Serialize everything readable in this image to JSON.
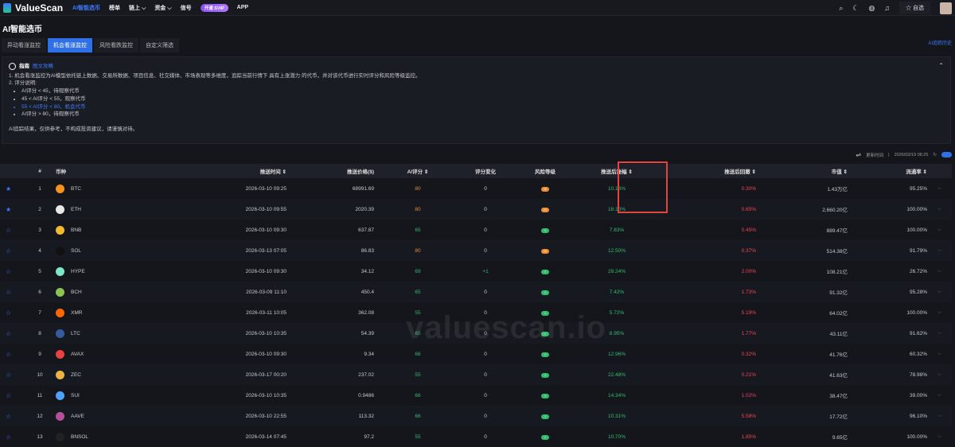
{
  "brand": "ValueScan",
  "nav": [
    "AI智能选币",
    "榜单",
    "链上 ⌵",
    "资金 ⌵",
    "信号"
  ],
  "svip": "开通 SVIP",
  "app": "APP",
  "fav": "☆ 自选",
  "title": "AI智能选币",
  "tabs": [
    "异动看涨监控",
    "机会看涨监控",
    "风险看跌监控",
    "自定义筛选"
  ],
  "history": "AI追踪历史",
  "guide": {
    "title": "指南",
    "link": "图文攻略",
    "line1": "1. 机会看涨监控为AI模型依托链上数据、交易所数据、项目信息、社交媒体、市场表现等多维度，追踪当前行情下 具有上涨潜力 的代币，并对该代币进行实时评分和风险等级监控。",
    "line2": "2. 评分说明:",
    "items": [
      "AI评分 < 45，待观察代币",
      "45 < AI评分 < 55，观察代币",
      "55 < AI评分 < 80，机会代币",
      "AI评分 > 80，待观察代币"
    ],
    "disclaimer": "AI追踪结果，仅供参考，不构成投资建议，请谨慎对待。"
  },
  "update": {
    "label": "更新时间",
    "time": "2026/03/19 08:25"
  },
  "headers": [
    "#",
    "币种",
    "推送时间 ⇕",
    "推送价格($)",
    "AI评分 ⇕",
    "评分变化",
    "风险等级",
    "推送后涨幅 ⇕",
    "推送后回撤 ⇕",
    "市值 ⇕",
    "流通率 ⇕"
  ],
  "rows": [
    {
      "n": "1",
      "sym": "BTC",
      "time": "2026-03-10 09:25",
      "price": "68991.69",
      "score": "80",
      "chg": "0",
      "risk": "high",
      "rise": "10.16%",
      "dd": "0.30%",
      "mcap": "1.43万亿",
      "circ": "95.25%",
      "fav": true,
      "color": "#f7931a"
    },
    {
      "n": "2",
      "sym": "ETH",
      "time": "2026-03-10 09:55",
      "price": "2020.39",
      "score": "80",
      "chg": "0",
      "risk": "high",
      "rise": "18.10%",
      "dd": "0.65%",
      "mcap": "2,660.20亿",
      "circ": "100.00%",
      "fav": true,
      "color": "#e8e8e8"
    },
    {
      "n": "3",
      "sym": "BNB",
      "time": "2026-03-10 09:30",
      "price": "637.87",
      "score": "65",
      "chg": "0",
      "risk": "low",
      "rise": "7.83%",
      "dd": "0.45%",
      "mcap": "889.47亿",
      "circ": "100.00%",
      "fav": false,
      "color": "#f3ba2f"
    },
    {
      "n": "4",
      "sym": "SOL",
      "time": "2026-03-13 07:05",
      "price": "86.83",
      "score": "80",
      "chg": "0",
      "risk": "high",
      "rise": "12.50%",
      "dd": "0.37%",
      "mcap": "514.38亿",
      "circ": "91.79%",
      "fav": false,
      "color": "#111111"
    },
    {
      "n": "5",
      "sym": "HYPE",
      "time": "2026-03-10 09:30",
      "price": "34.12",
      "score": "69",
      "chg": "+1",
      "risk": "low",
      "rise": "28.24%",
      "dd": "2.00%",
      "mcap": "108.21亿",
      "circ": "26.72%",
      "fav": false,
      "color": "#7de8c9"
    },
    {
      "n": "6",
      "sym": "BCH",
      "time": "2026-03-09 11:10",
      "price": "450.4",
      "score": "65",
      "chg": "0",
      "risk": "low",
      "rise": "7.42%",
      "dd": "1.73%",
      "mcap": "91.32亿",
      "circ": "95.28%",
      "fav": false,
      "color": "#8dc351"
    },
    {
      "n": "7",
      "sym": "XMR",
      "time": "2026-03-11 10:05",
      "price": "362.08",
      "score": "55",
      "chg": "0",
      "risk": "low",
      "rise": "5.72%",
      "dd": "5.19%",
      "mcap": "64.02亿",
      "circ": "100.00%",
      "fav": false,
      "color": "#ff6600"
    },
    {
      "n": "8",
      "sym": "LTC",
      "time": "2026-03-10 10:35",
      "price": "54.39",
      "score": "65",
      "chg": "0",
      "risk": "low",
      "rise": "8.95%",
      "dd": "1.77%",
      "mcap": "43.11亿",
      "circ": "91.62%",
      "fav": false,
      "color": "#345d9d"
    },
    {
      "n": "9",
      "sym": "AVAX",
      "time": "2026-03-10 09:30",
      "price": "9.34",
      "score": "66",
      "chg": "0",
      "risk": "low",
      "rise": "12.96%",
      "dd": "0.32%",
      "mcap": "41.76亿",
      "circ": "60.32%",
      "fav": false,
      "color": "#e84142"
    },
    {
      "n": "10",
      "sym": "ZEC",
      "time": "2026-03-17 00:20",
      "price": "237.02",
      "score": "55",
      "chg": "0",
      "risk": "low",
      "rise": "22.48%",
      "dd": "0.21%",
      "mcap": "41.63亿",
      "circ": "78.98%",
      "fav": false,
      "color": "#ecb244"
    },
    {
      "n": "11",
      "sym": "SUI",
      "time": "2026-03-10 10:35",
      "price": "0.9486",
      "score": "66",
      "chg": "0",
      "risk": "low",
      "rise": "14.34%",
      "dd": "1.02%",
      "mcap": "38.47亿",
      "circ": "39.00%",
      "fav": false,
      "color": "#4da2ff"
    },
    {
      "n": "12",
      "sym": "AAVE",
      "time": "2026-03-10 22:55",
      "price": "113.32",
      "score": "66",
      "chg": "0",
      "risk": "low",
      "rise": "10.31%",
      "dd": "5.58%",
      "mcap": "17.72亿",
      "circ": "96.10%",
      "fav": false,
      "color": "#b6509e"
    },
    {
      "n": "13",
      "sym": "BNSOL",
      "time": "2026-03-14 07:45",
      "price": "97.2",
      "score": "55",
      "chg": "0",
      "risk": "low",
      "rise": "10.70%",
      "dd": "1.85%",
      "mcap": "9.65亿",
      "circ": "100.00%",
      "fav": false,
      "color": "#222222"
    }
  ],
  "risk_labels": {
    "high": "III",
    "low": "I"
  },
  "watermark": "valuescan.io"
}
